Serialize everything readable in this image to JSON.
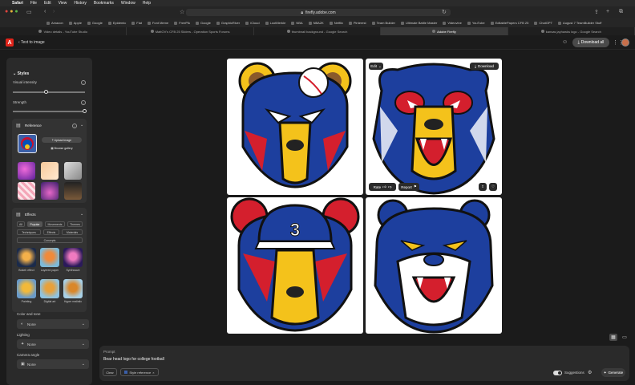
{
  "menubar": {
    "items": [
      "Safari",
      "File",
      "Edit",
      "View",
      "History",
      "Bookmarks",
      "Window",
      "Help"
    ]
  },
  "browser": {
    "url": "firefly.adobe.com"
  },
  "favorites": [
    "Amazon",
    "Apple",
    "Google",
    "Epidemic",
    "Flat",
    "Font Meme",
    "FreePik",
    "Google",
    "GraphicRiver",
    "iCloud",
    "LootMerkle",
    "NBA",
    "NBA2K",
    "Netflix",
    "Pinterest",
    "Team Builder",
    "Ultimate Battle Master",
    "Videovine",
    "YouTube",
    "EditablePapers CFB 25",
    "ChatGPT",
    "August 7 TeamBuilder Stuff"
  ],
  "tabs": [
    {
      "label": "Video details - YouTube Studio",
      "active": false
    },
    {
      "label": "MattOV's CFB 25 Sliders - Operation Sports Forums",
      "active": false
    },
    {
      "label": "thumbnail background - Google Search",
      "active": false
    },
    {
      "label": "Adobe Firefly",
      "active": true
    },
    {
      "label": "kansas jayhawks logo - Google Search",
      "active": false
    }
  ],
  "app": {
    "breadcrumb": "Text to image",
    "download_all": "Download all"
  },
  "panel": {
    "styles_title": "Styles",
    "visual_intensity": "Visual intensity",
    "strength": "Strength",
    "visual_intensity_level": 0.45,
    "strength_level": 1.0,
    "reference_title": "Reference",
    "upload_image": "Upload image",
    "browse_gallery": "Browse gallery",
    "effects_title": "Effects",
    "effect_chips": [
      "All",
      "Popular",
      "Movements",
      "Themes",
      "Techniques",
      "Effects",
      "Materials",
      "Concepts"
    ],
    "selected_chip": "Popular",
    "effects": [
      "Bokeh effect",
      "Layered paper",
      "Synthwave",
      "Painting",
      "Digital art",
      "Hyper realistic"
    ],
    "color_tone_label": "Color and tone",
    "color_tone_value": "None",
    "lighting_label": "Lighting",
    "lighting_value": "None",
    "camera_angle_label": "Camera angle",
    "camera_angle_value": "None"
  },
  "overlay": {
    "edit": "Edit",
    "download": "Download",
    "rate": "Rate",
    "report": "Report"
  },
  "prompt": {
    "label": "Prompt",
    "text": "Bear head logo for college football",
    "clear": "Clear",
    "style_reference": "Style reference",
    "suggestions": "Suggestions",
    "generate": "Generate"
  },
  "colors": {
    "accent": "#e1251b",
    "navy": "#1d3f9e",
    "red": "#d41f2d",
    "yellow": "#f4c21b",
    "brown": "#8a5a2b"
  }
}
